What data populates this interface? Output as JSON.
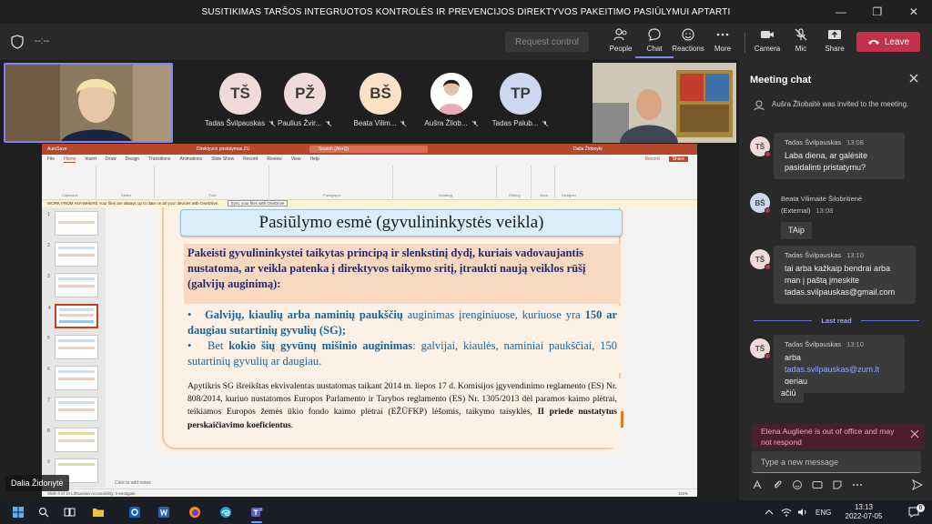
{
  "window": {
    "title": "SUSITIKIMAS TARŠOS INTEGRUOTOS KONTROLĖS IR PREVENCIJOS DIREKTYVOS PAKEITIMO PASIŪLYMUI APTARTI"
  },
  "toolbar": {
    "timer": "--:--",
    "request_control": "Request control",
    "people": "People",
    "chat": "Chat",
    "reactions": "Reactions",
    "more": "More",
    "camera": "Camera",
    "mic": "Mic",
    "share": "Share",
    "leave": "Leave"
  },
  "participants": [
    {
      "initials": "TŠ",
      "name": "Tadas Švilpauskas",
      "color": "#f1dada"
    },
    {
      "initials": "PŽ",
      "name": "Paulius Žvir...",
      "color": "#f1dada"
    },
    {
      "initials": "BŠ",
      "name": "Beata Vilim...",
      "color": "#fbe1c6"
    },
    {
      "initials": "",
      "name": "Aušra Žliob...",
      "color": "#ffffff"
    },
    {
      "initials": "TP",
      "name": "Tadas Palub...",
      "color": "#cdd7ef"
    }
  ],
  "presenter_name": "Dalia Židonytė",
  "powerpoint": {
    "autosave": "AutoSave",
    "filename": "Direktyvos pristatymas.ZU",
    "search": "Search (Alt+Q)",
    "user": "Dalia Židonytė",
    "menu": [
      "File",
      "Home",
      "Insert",
      "Draw",
      "Design",
      "Transitions",
      "Animations",
      "Slide Show",
      "Record",
      "Review",
      "View",
      "Help"
    ],
    "record_btn": "Record",
    "share_btn": "Share",
    "ribbon_groups": [
      "Clipboard",
      "Slides",
      "Font",
      "Paragraph",
      "Drawing",
      "Editing",
      "Voice",
      "Designer"
    ],
    "info_bar": "WORK FROM ANYWHERE   Your files are always up to date on all your devices with OneDrive.",
    "info_button": "Sync your files with OneDrive",
    "notes": "Click to add notes",
    "status": "Slide 4 of 10    Lithuanian    Accessibility: Investigate",
    "zoom": "116%"
  },
  "slide": {
    "title": "Pasiūlymo esmė (gyvulininkystės veikla)",
    "box1": "Pakeisti gyvulininkystei taikytas principą ir slenkstinį dydį, kuriais vadovaujantis nustatoma, ar veikla patenka į direktyvos taikymo sritį, įtraukti naują veiklos rūšį (galvijų auginimą):",
    "b1_bold": "Galvijų, kiaulių arba naminių paukščių",
    "b1_text": " auginimas įrenginiuose, kuriuose yra ",
    "b1_bold2": "150 ar daugiau sutartinių gyvulių (SG);",
    "b2_text": "Bet ",
    "b2_bold": "kokio šių gyvūnų mišinio auginimas",
    "b2_text2": ": galvijai, kiaulės, naminiai paukščiai, 150 sutartinių gyvulių ar daugiau.",
    "box3_text": "Apytikris SG išreikštas ekvivalentas nustatomas taikant 2014 m. liepos 17 d. Komisijos įgyvendinimo reglamento (ES) Nr. 808/2014, kuriuo nustatomos Europos Parlamento ir Tarybos reglamento (ES) Nr. 1305/2013 dėl paramos kaimo plėtrai, teikiamos Europos žemės ūkio fondo kaimo plėtrai (EŽŪFKP) lėšomis, taikymo taisyklės, ",
    "box3_bold": "II priede nustatytus perskaičiavimo koeficientus",
    "box3_end": "."
  },
  "chat": {
    "header": "Meeting chat",
    "system_message": "Aušra Žliobaitė was invited to the meeting.",
    "messages": [
      {
        "initials": "TŠ",
        "sender": "Tadas Švilpauskas",
        "time": "13:08",
        "text": "Laba diena, ar galėsite pasidalinti pristatymu?"
      },
      {
        "initials": "BŠ",
        "sender": "Beata Vilimaitė Šilobritienė (External)",
        "time": "13:08",
        "text": "TAip"
      },
      {
        "initials": "TŠ",
        "sender": "Tadas Švilpauskas",
        "time": "13:10",
        "text": "tai arba kažkaip bendrai arba man į paštą įmeskite tadas.svilpauskas@gmail.com"
      },
      {
        "initials": "TŠ",
        "sender": "Tadas Švilpauskas",
        "time": "13:10",
        "text_prefix": "arba ",
        "link": "tadas.svilpauskas@zum.lt",
        "text_suffix": "geriau"
      },
      {
        "text": "ačiū"
      }
    ],
    "last_read": "Last read",
    "notice": "Elena Auglienė is out of office and may not respond",
    "compose_placeholder": "Type a new message"
  },
  "taskbar": {
    "language": "ENG",
    "time": "13:13",
    "date": "2022-07-05",
    "notifications": "6"
  }
}
